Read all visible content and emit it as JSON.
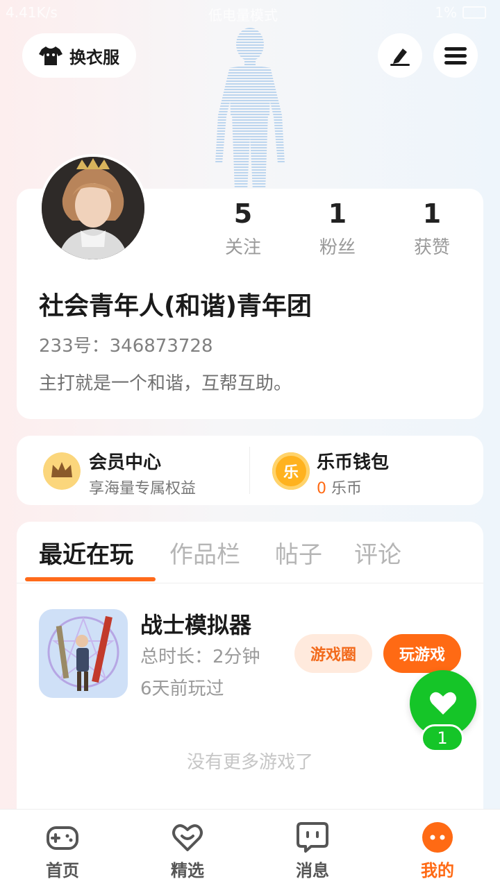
{
  "status_bar": {
    "left": "4.41K/s",
    "center": "低电量模式",
    "battery": "1%"
  },
  "header": {
    "dress_label": "换衣服",
    "edit_icon": "pen-icon",
    "menu_icon": "hamburger-icon"
  },
  "profile": {
    "stats": [
      {
        "value": "5",
        "label": "关注"
      },
      {
        "value": "1",
        "label": "粉丝"
      },
      {
        "value": "1",
        "label": "获赞"
      }
    ],
    "nickname": "社会青年人(和谐)青年团",
    "id_text": "233号：346873728",
    "bio": "主打就是一个和谐，互帮互助。"
  },
  "wallet": {
    "member_title": "会员中心",
    "member_sub": "享海量专属权益",
    "coin_title": "乐币钱包",
    "coin_amount": "0",
    "coin_unit": "乐币",
    "coin_icon_char": "乐"
  },
  "tabs": [
    "最近在玩",
    "作品栏",
    "帖子",
    "评论"
  ],
  "game": {
    "title": "战士模拟器",
    "duration": "总时长：2分钟",
    "last_played": "6天前玩过",
    "circle_button": "游戏圈",
    "play_button": "玩游戏"
  },
  "no_more_text": "没有更多游戏了",
  "fab": {
    "icon": "heart-icon",
    "badge": "1"
  },
  "bottom_nav": [
    {
      "label": "首页",
      "icon": "gamepad-icon",
      "active": false
    },
    {
      "label": "精选",
      "icon": "heart-icon",
      "active": false
    },
    {
      "label": "消息",
      "icon": "chat-icon",
      "active": false
    },
    {
      "label": "我的",
      "icon": "face-icon",
      "active": true
    }
  ],
  "colors": {
    "accent": "#ff6a14",
    "fab_green": "#15c528"
  }
}
